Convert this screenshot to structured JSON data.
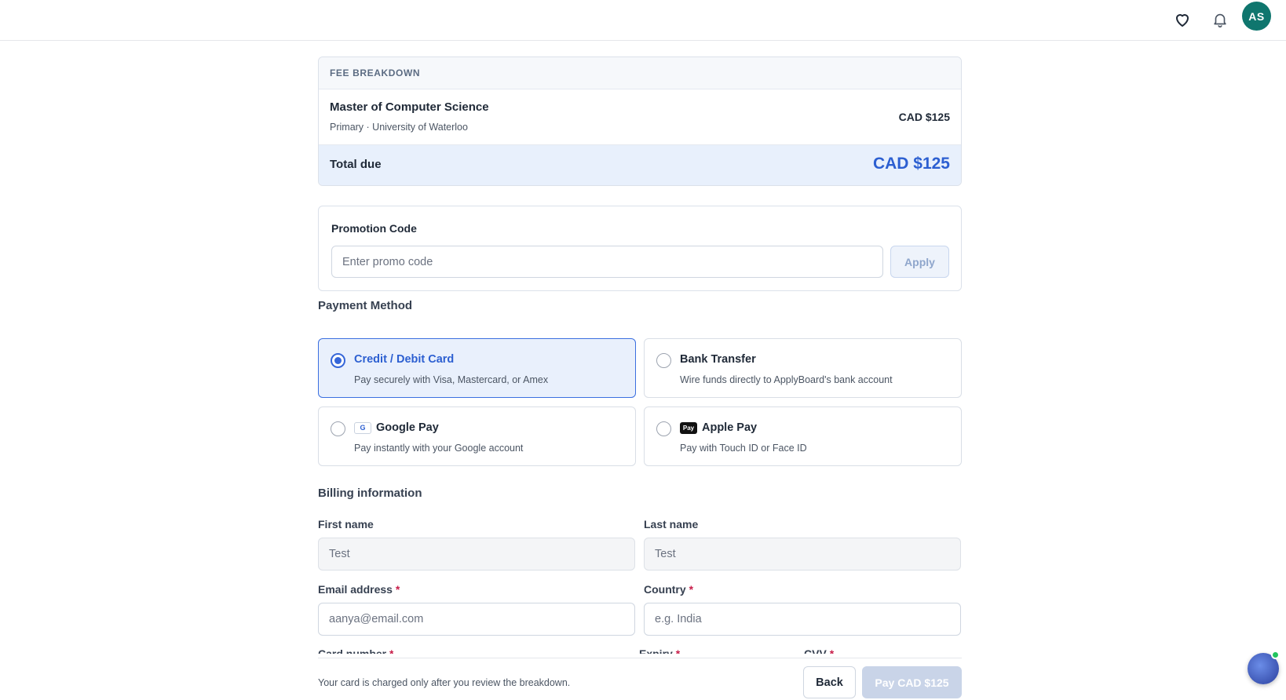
{
  "header": {
    "icons": {
      "favorites": "heart-icon",
      "notifications": "bell-icon"
    },
    "avatar_initials": "AS"
  },
  "fee_breakdown": {
    "heading": "FEE BREAKDOWN",
    "item": {
      "program": "Master of Computer Science",
      "detail": "Primary · University of Waterloo",
      "amount": "CAD $125"
    },
    "total_label": "Total due",
    "total_amount": "CAD $125"
  },
  "promo": {
    "label": "Promotion Code",
    "placeholder": "Enter promo code",
    "apply_label": "Apply"
  },
  "payment_method": {
    "title": "Payment Method",
    "options": [
      {
        "title": "Credit / Debit Card",
        "desc": "Pay securely with Visa, Mastercard, or Amex",
        "selected": true
      },
      {
        "title": "Bank Transfer",
        "desc": "Wire funds directly to ApplyBoard's bank account",
        "selected": false
      },
      {
        "title": "Google Pay",
        "badge": "G",
        "desc": "Pay instantly with your Google account",
        "selected": false
      },
      {
        "title": "Apple Pay",
        "badge": "Pay",
        "desc": "Pay with Touch ID or Face ID",
        "selected": false
      }
    ]
  },
  "billing": {
    "title": "Billing information",
    "first_name": {
      "label": "First name",
      "value": "Test"
    },
    "last_name": {
      "label": "Last name",
      "value": "Test"
    },
    "email": {
      "label": "Email address",
      "required": "*",
      "placeholder": "aanya@email.com"
    },
    "country": {
      "label": "Country",
      "required": "*",
      "placeholder": "e.g. India"
    },
    "card_number": {
      "label": "Card number",
      "required": "*"
    },
    "expiry": {
      "label": "Expiry",
      "required": "*"
    },
    "cvv": {
      "label": "CVV",
      "required": "*"
    }
  },
  "footer": {
    "note": "Your card is charged only after you review the breakdown.",
    "back_label": "Back",
    "pay_label": "Pay CAD $125"
  },
  "colors": {
    "accent": "#2c5fd1",
    "avatar": "#0f766e",
    "required": "#c81e4a",
    "selected_bg": "#e9f0fc"
  }
}
